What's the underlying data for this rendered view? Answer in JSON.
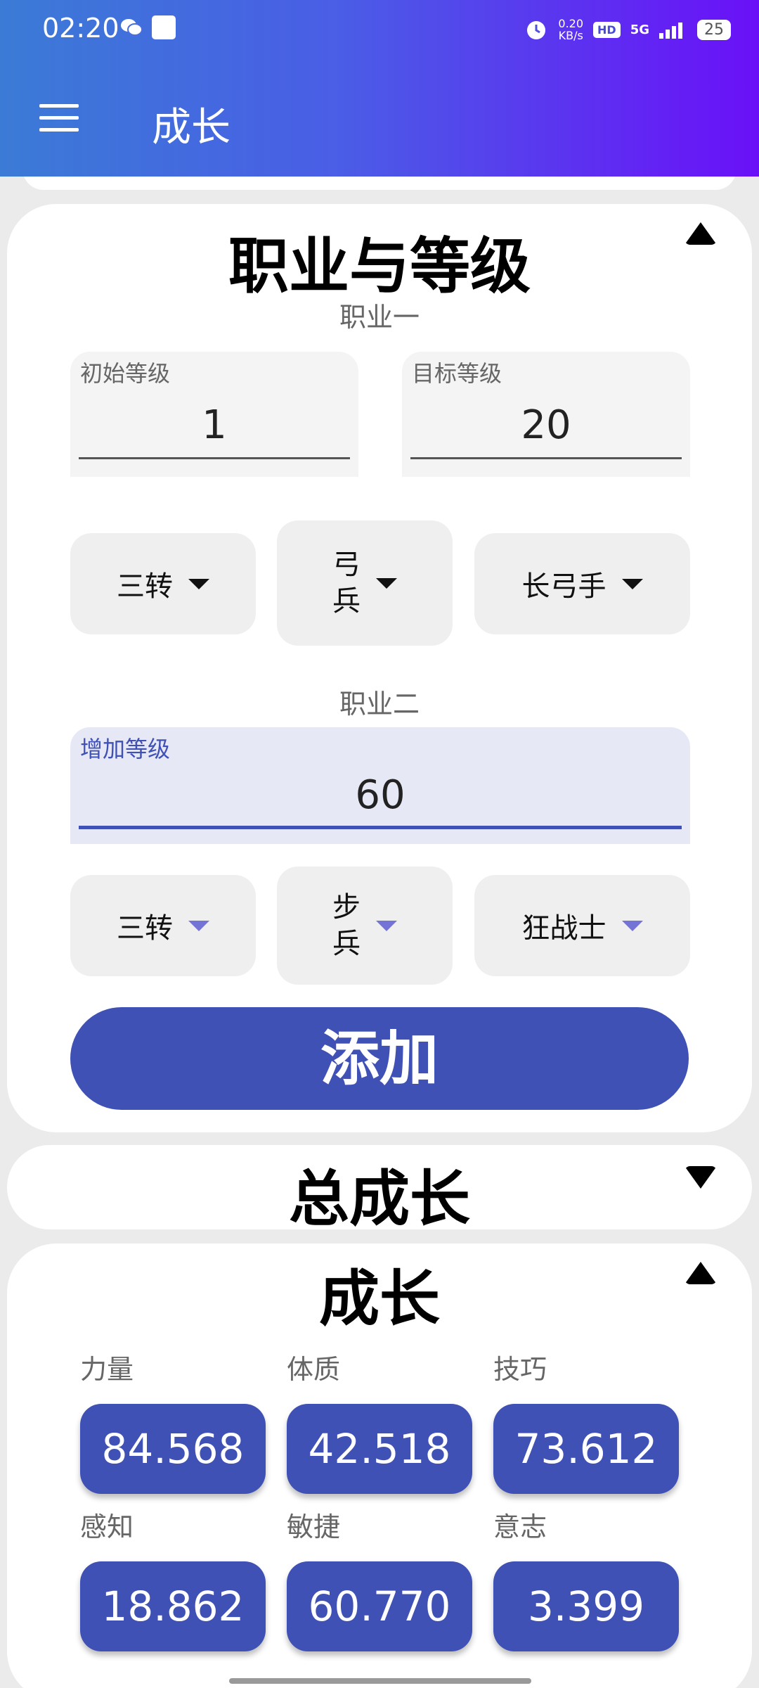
{
  "status_bar": {
    "time": "02:20",
    "net_speed": "0.20\nKB/s",
    "hd": "HD",
    "signal": "5G",
    "battery": "25"
  },
  "app_bar": {
    "title": "成长"
  },
  "job_card": {
    "title": "职业与等级",
    "job1": {
      "label": "职业一",
      "start_level": {
        "label": "初始等级",
        "value": "1"
      },
      "target_level": {
        "label": "目标等级",
        "value": "20"
      },
      "advance": "三转",
      "category": "弓兵",
      "class": "长弓手"
    },
    "job2": {
      "label": "职业二",
      "add_level": {
        "label": "增加等级",
        "value": "60"
      },
      "advance": "三转",
      "category": "步兵",
      "class": "狂战士"
    },
    "add_button": "添加"
  },
  "total_card": {
    "title": "总成长"
  },
  "growth_card": {
    "title": "成长",
    "stats": [
      {
        "label": "力量",
        "value": "84.568"
      },
      {
        "label": "体质",
        "value": "42.518"
      },
      {
        "label": "技巧",
        "value": "73.612"
      },
      {
        "label": "感知",
        "value": "18.862"
      },
      {
        "label": "敏捷",
        "value": "60.770"
      },
      {
        "label": "意志",
        "value": "3.399"
      }
    ]
  },
  "colors": {
    "accent": "#3f51b5",
    "appbar_start": "#3b7bd6",
    "appbar_end": "#6a10f8"
  }
}
